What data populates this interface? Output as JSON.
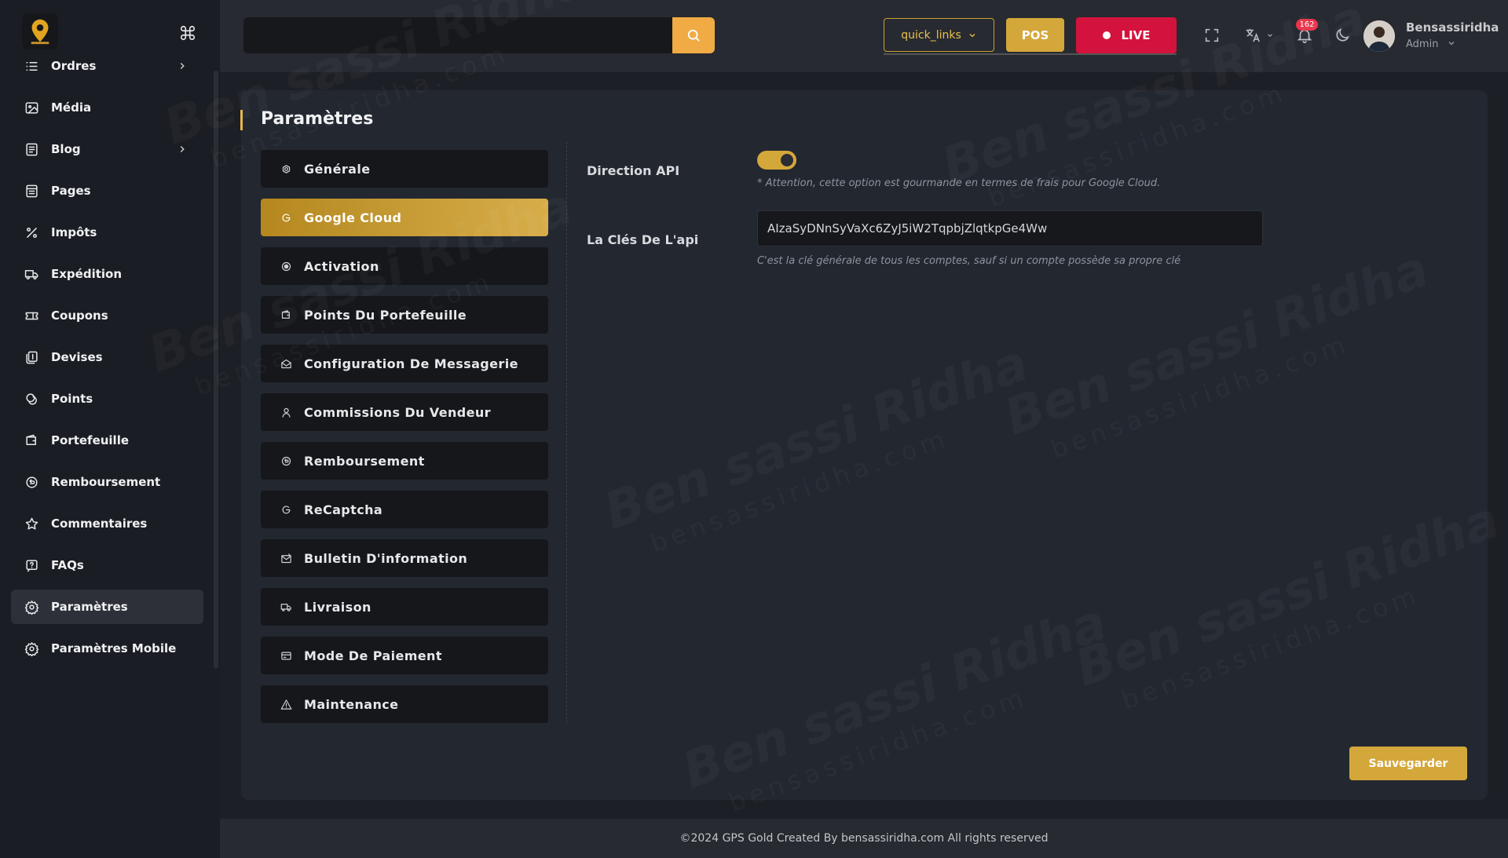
{
  "sidebar": {
    "items": [
      {
        "label": "Ordres",
        "icon": "list-icon",
        "has_chevron": true
      },
      {
        "label": "Média",
        "icon": "image-icon",
        "has_chevron": false
      },
      {
        "label": "Blog",
        "icon": "blog-icon",
        "has_chevron": true
      },
      {
        "label": "Pages",
        "icon": "pages-icon",
        "has_chevron": false
      },
      {
        "label": "Impôts",
        "icon": "percent-icon",
        "has_chevron": false
      },
      {
        "label": "Expédition",
        "icon": "truck-icon",
        "has_chevron": false
      },
      {
        "label": "Coupons",
        "icon": "ticket-icon",
        "has_chevron": false
      },
      {
        "label": "Devises",
        "icon": "currency-icon",
        "has_chevron": false
      },
      {
        "label": "Points",
        "icon": "coins-icon",
        "has_chevron": false
      },
      {
        "label": "Portefeuille",
        "icon": "wallet-icon",
        "has_chevron": false
      },
      {
        "label": "Remboursement",
        "icon": "refund-icon",
        "has_chevron": false
      },
      {
        "label": "Commentaires",
        "icon": "star-icon",
        "has_chevron": false
      },
      {
        "label": "FAQs",
        "icon": "question-icon",
        "has_chevron": false
      },
      {
        "label": "Paramètres",
        "icon": "gear-icon",
        "has_chevron": false,
        "active": true
      },
      {
        "label": "Paramètres Mobile",
        "icon": "gear-icon",
        "has_chevron": false
      }
    ]
  },
  "header": {
    "search_placeholder": "",
    "quick_links_label": "quick_links",
    "pos_label": "POS",
    "live_label": "LIVE",
    "notification_count": "162",
    "user_name": "Bensassiridha",
    "user_role": "Admin"
  },
  "page": {
    "title": "Paramètres",
    "tabs": [
      {
        "label": "Générale",
        "icon": "settings-icon"
      },
      {
        "label": "Google Cloud",
        "icon": "google-icon",
        "active": true
      },
      {
        "label": "Activation",
        "icon": "radio-icon"
      },
      {
        "label": "Points Du Portefeuille",
        "icon": "wallet-icon"
      },
      {
        "label": "Configuration De Messagerie",
        "icon": "mail-open-icon"
      },
      {
        "label": "Commissions Du Vendeur",
        "icon": "user-icon"
      },
      {
        "label": "Remboursement",
        "icon": "refund-icon"
      },
      {
        "label": "ReCaptcha",
        "icon": "google-icon"
      },
      {
        "label": "Bulletin D'information",
        "icon": "newsletter-icon"
      },
      {
        "label": "Livraison",
        "icon": "truck-icon"
      },
      {
        "label": "Mode De Paiement",
        "icon": "card-icon"
      },
      {
        "label": "Maintenance",
        "icon": "warning-icon"
      }
    ],
    "direction_api_label": "Direction API",
    "direction_api_enabled": true,
    "direction_api_hint": "* Attention, cette option est gourmande en termes de frais pour Google Cloud.",
    "api_key_label": "La Clés De L'api",
    "api_key_value": "AIzaSyDNnSyVaXc6ZyJ5iW2TqpbjZlqtkpGe4Ww",
    "api_key_hint": "C'est la clé générale de tous les comptes, sauf si un compte possède sa propre clé",
    "save_label": "Sauvegarder"
  },
  "watermark": {
    "name": "Ben sassi Ridha",
    "site": "bensassiridha.com"
  },
  "footer": {
    "text": "©2024 GPS Gold Created By bensassiridha.com All rights reserved"
  },
  "colors": {
    "accent": "#d4a73a",
    "live": "#d3133d",
    "search_button": "#f0ab45"
  }
}
